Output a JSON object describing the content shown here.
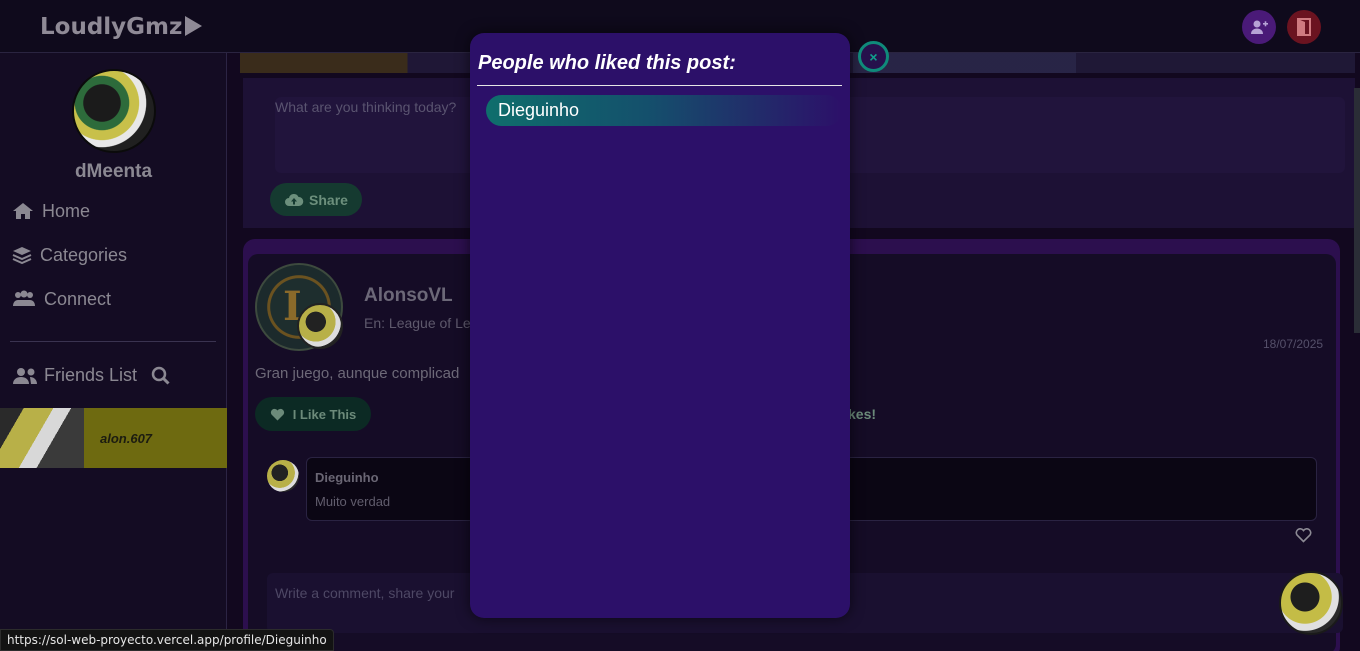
{
  "app": {
    "name": "LoudlyGmz"
  },
  "user": {
    "username": "dMeenta"
  },
  "sidebar": {
    "nav": [
      {
        "label": "Home",
        "icon": "home-icon"
      },
      {
        "label": "Categories",
        "icon": "layers-icon"
      },
      {
        "label": "Connect",
        "icon": "users-icon"
      }
    ],
    "friends_label": "Friends List",
    "friends": [
      {
        "name": "alon.607"
      }
    ]
  },
  "compose": {
    "placeholder": "What are you thinking today?",
    "share_label": "Share"
  },
  "post": {
    "author": "AlonsoVL",
    "category": "En: League of Le",
    "date": "18/07/2025",
    "body": "Gran juego, aunque complicad",
    "like_label": "I Like This",
    "likes_text": "kes!",
    "comment": {
      "author": "Dieguinho",
      "text": "Muito verdad"
    },
    "write_placeholder": "Write a comment, share your"
  },
  "modal": {
    "title": "People who liked this post:",
    "close_label": "×",
    "likers": [
      "Dieguinho"
    ]
  },
  "status_bar": {
    "url": "https://sol-web-proyecto.vercel.app/profile/Dieguinho"
  },
  "colors": {
    "modal_bg": "#2c1069",
    "accent_teal": "#0f8a7a",
    "friend_card": "#6e6a10",
    "exit_button": "#6b1320",
    "add_button": "#4a1a78"
  }
}
